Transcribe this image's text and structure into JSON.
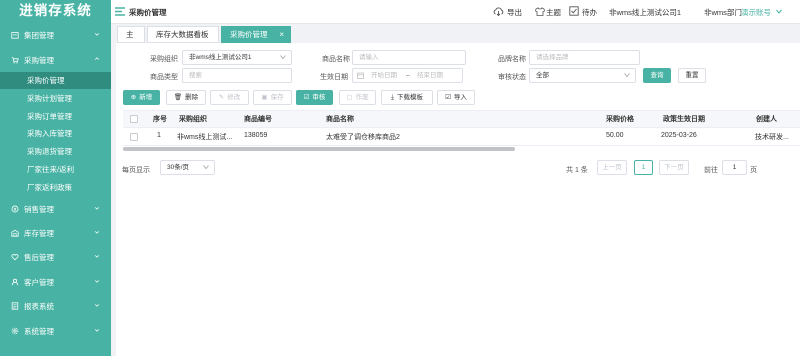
{
  "app": {
    "title": "进销存系统"
  },
  "sidebar": {
    "groups": [
      {
        "label": "集团管理",
        "icon": "building-icon"
      },
      {
        "label": "采购管理",
        "icon": "cart-icon"
      },
      {
        "label": "销售管理",
        "icon": "sales-icon"
      },
      {
        "label": "库存管理",
        "icon": "warehouse-icon"
      },
      {
        "label": "售后管理",
        "icon": "heart-icon"
      },
      {
        "label": "客户管理",
        "icon": "customer-icon"
      },
      {
        "label": "报表系统",
        "icon": "report-icon"
      },
      {
        "label": "系统管理",
        "icon": "settings-icon"
      }
    ],
    "sub_items": [
      "采购价管理",
      "采购计划管理",
      "采购订单管理",
      "采购入库管理",
      "采购退货管理",
      "厂家往来/返利",
      "厂家返利政策"
    ],
    "active_sub": "采购价管理",
    "accent": "#48b3a4"
  },
  "header": {
    "page_title": "采购价管理",
    "export_label": "导出",
    "theme_label": "主题",
    "todo_label": "待办",
    "company": "非wms线上测试公司1",
    "department": "非wms部门",
    "account": "演示账号"
  },
  "tabs": [
    {
      "label": "主页",
      "active": false,
      "closable": false
    },
    {
      "label": "库存大数据看板",
      "active": false,
      "closable": false
    },
    {
      "label": "采购价管理",
      "active": true,
      "closable": true
    }
  ],
  "filters": {
    "org_label": "采购组织",
    "org_value": "非wms线上测试公司1",
    "product_name_label": "商品名称",
    "product_name_placeholder": "请输入",
    "brand_label": "品牌名称",
    "brand_placeholder": "请选择品牌",
    "type_label": "商品类型",
    "type_placeholder": "搜索",
    "date_label": "生效日期",
    "date_start_placeholder": "开始日期",
    "date_sep": "–",
    "date_end_placeholder": "结束日期",
    "status_label": "审核状态",
    "status_value": "全部",
    "query_label": "查询",
    "reset_label": "重置"
  },
  "toolbar": {
    "add": "新增",
    "delete": "删除",
    "edit": "修改",
    "save": "保存",
    "audit": "审核",
    "void": "作废",
    "download_template": "下载模板",
    "import": "导入"
  },
  "table": {
    "columns": [
      "序号",
      "采购组织",
      "商品编号",
      "商品名称",
      "采购价格",
      "政策生效日期",
      "创建人"
    ],
    "rows": [
      {
        "index": "1",
        "org": "非wms线上测试...",
        "code": "138059",
        "name": "太难受了调仓移库商品2",
        "price": "50.00",
        "date": "2025-03-26",
        "creator": "技术研发..."
      }
    ]
  },
  "pagination": {
    "page_size": "30条/页",
    "page_size_label": "每页显示",
    "total": "共 1 条",
    "prev": "上一页",
    "current": "1",
    "next": "下一页",
    "goto_label": "前往",
    "goto_value": "1",
    "page_unit": "页"
  }
}
